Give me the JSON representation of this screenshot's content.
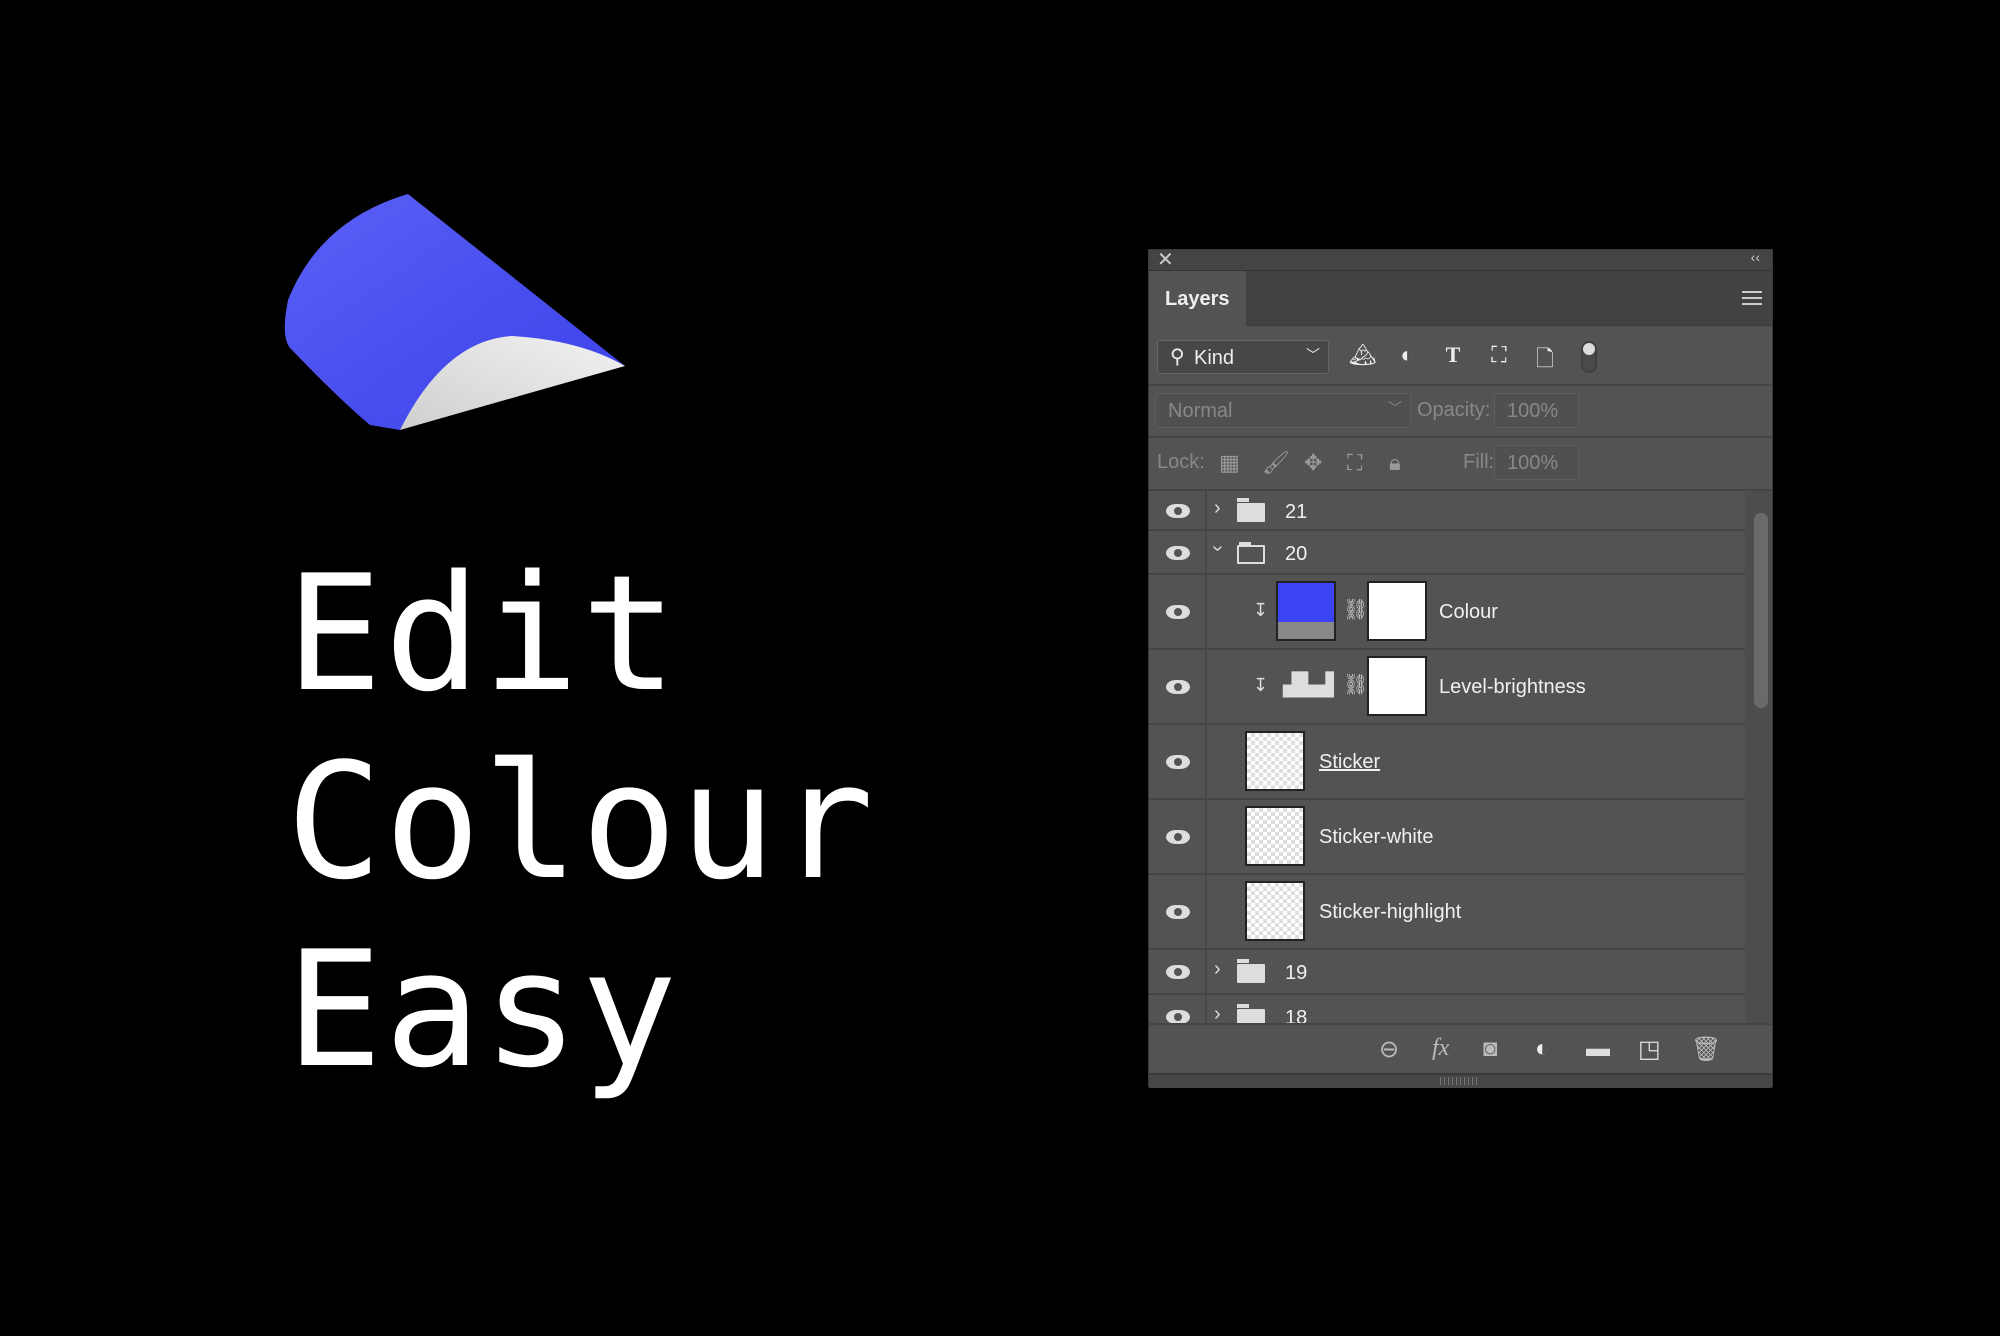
{
  "hero": {
    "lines": [
      "Edit",
      "Colour",
      "Easy"
    ]
  },
  "colors": {
    "sticker": "#4a50f0",
    "background": "#000000",
    "panel": "#535353"
  },
  "panel": {
    "close_icon": "close-icon",
    "collapse_label": "‹‹",
    "tab": "Layers",
    "filter": {
      "kind_label": "Kind",
      "icons": [
        "image-filter-icon",
        "adjustment-filter-icon",
        "type-filter-icon",
        "shape-filter-icon",
        "smart-object-filter-icon"
      ]
    },
    "blend_mode": "Normal",
    "opacity_label": "Opacity:",
    "opacity_value": "100%",
    "lock_label": "Lock:",
    "fill_label": "Fill:",
    "fill_value": "100%",
    "layers": [
      {
        "name": "21",
        "type": "group",
        "expanded": false,
        "visible": true
      },
      {
        "name": "20",
        "type": "group",
        "expanded": true,
        "visible": true
      },
      {
        "name": "Colour",
        "type": "fill",
        "visible": true,
        "clipped": true,
        "color": "#3b44f5"
      },
      {
        "name": "Level-brightness",
        "type": "levels",
        "visible": true,
        "clipped": true
      },
      {
        "name": "Sticker",
        "type": "pixel",
        "visible": true
      },
      {
        "name": "Sticker-white",
        "type": "pixel",
        "visible": true
      },
      {
        "name": "Sticker-highlight",
        "type": "pixel",
        "visible": true
      },
      {
        "name": "19",
        "type": "group",
        "expanded": false,
        "visible": true
      },
      {
        "name": "18",
        "type": "group",
        "expanded": false,
        "visible": true
      }
    ],
    "footer_icons": [
      "link-layers-icon",
      "fx-icon",
      "add-mask-icon",
      "adjustment-layer-icon",
      "new-group-icon",
      "new-layer-icon",
      "delete-icon"
    ]
  }
}
